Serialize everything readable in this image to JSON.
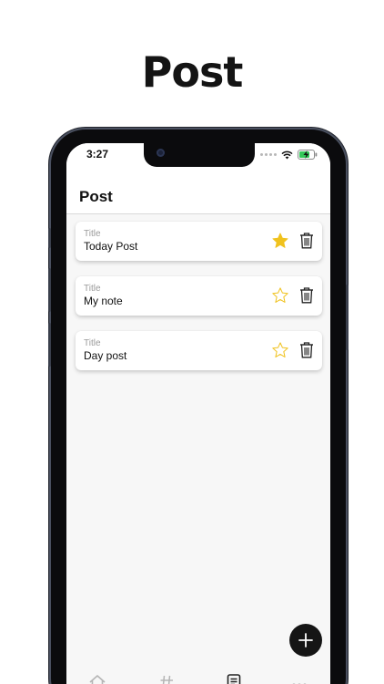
{
  "page": {
    "headline": "Post"
  },
  "status_bar": {
    "time": "3:27"
  },
  "header": {
    "title": "Post"
  },
  "posts": [
    {
      "caption": "Title",
      "title": "Today Post",
      "starred": true
    },
    {
      "caption": "Title",
      "title": "My note",
      "starred": false
    },
    {
      "caption": "Title",
      "title": "Day post",
      "starred": false
    }
  ],
  "colors": {
    "star": "#f0c21e",
    "fab": "#151515",
    "text": "#111111",
    "caption": "#9a9a9a"
  },
  "icons": {
    "status": [
      "wifi-icon",
      "battery-charging-icon"
    ],
    "card": [
      "star-icon",
      "trash-icon"
    ],
    "fab": "plus-icon",
    "tabs": [
      "home-icon",
      "hashtag-icon",
      "document-icon",
      "more-icon"
    ]
  }
}
